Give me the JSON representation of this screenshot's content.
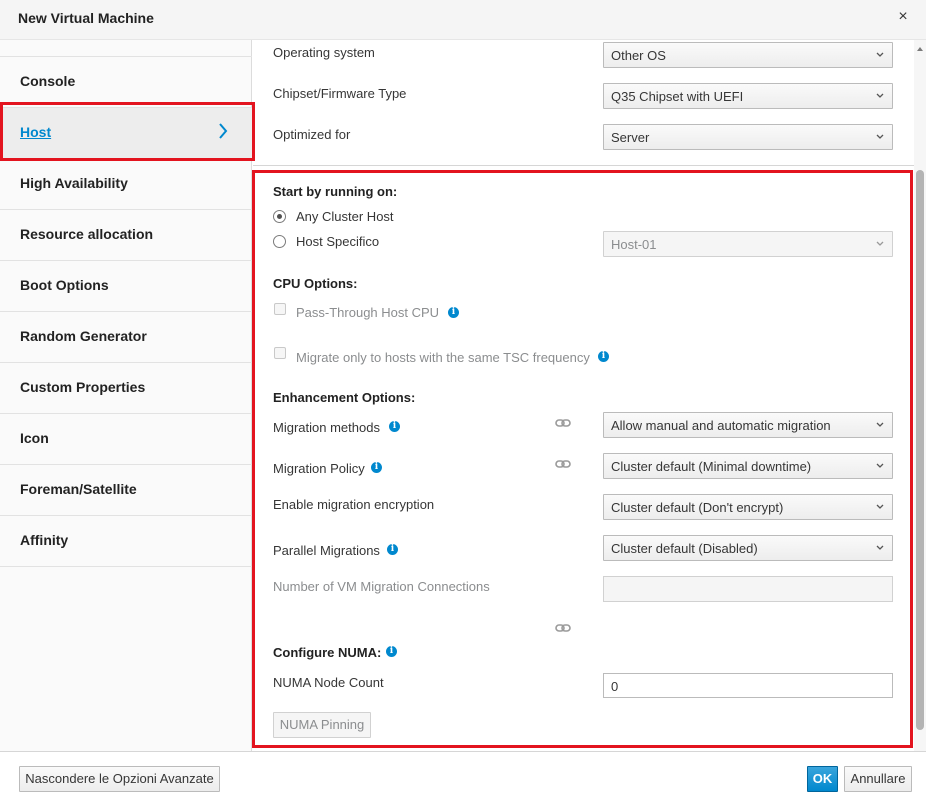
{
  "dialog": {
    "title": "New Virtual Machine",
    "close_glyph": "×"
  },
  "sidebar": {
    "items": [
      {
        "label": "Console",
        "active": false
      },
      {
        "label": "Host",
        "active": true
      },
      {
        "label": "High Availability",
        "active": false
      },
      {
        "label": "Resource allocation",
        "active": false
      },
      {
        "label": "Boot Options",
        "active": false
      },
      {
        "label": "Random Generator",
        "active": false
      },
      {
        "label": "Custom Properties",
        "active": false
      },
      {
        "label": "Icon",
        "active": false
      },
      {
        "label": "Foreman/Satellite",
        "active": false
      },
      {
        "label": "Affinity",
        "active": false
      }
    ]
  },
  "top_fields": {
    "os": {
      "label": "Operating system",
      "value": "Other OS"
    },
    "chipset": {
      "label": "Chipset/Firmware Type",
      "value": "Q35 Chipset with UEFI"
    },
    "optimized": {
      "label": "Optimized for",
      "value": "Server"
    }
  },
  "host": {
    "start_heading": "Start by running on:",
    "any_cluster_host": "Any Cluster Host",
    "host_specific": "Host Specifico",
    "host_select_value": "Host-01",
    "cpu_heading": "CPU Options:",
    "passthrough_cpu": "Pass-Through Host CPU",
    "migrate_tsc": "Migrate only to hosts with the same TSC frequency",
    "enhancement_heading": "Enhancement Options:",
    "migration_methods": {
      "label": "Migration methods",
      "value": "Allow manual and automatic migration"
    },
    "migration_policy": {
      "label": "Migration Policy",
      "value": "Cluster default (Minimal downtime)"
    },
    "migration_encryption": {
      "label": "Enable migration encryption",
      "value": "Cluster default (Don't encrypt)"
    },
    "parallel_migrations": {
      "label": "Parallel Migrations",
      "value": "Cluster default (Disabled)"
    },
    "vm_migration_connections": {
      "label": "Number of VM Migration Connections",
      "value": ""
    },
    "numa_heading": "Configure NUMA:",
    "numa_node_count": {
      "label": "NUMA Node Count",
      "value": "0"
    },
    "numa_pinning_button": "NUMA Pinning"
  },
  "footer": {
    "advanced_button": "Nascondere le Opzioni Avanzate",
    "ok_button": "OK",
    "cancel_button": "Annullare"
  },
  "colors": {
    "accent": "#0088ce",
    "highlight_border": "#e3141f",
    "primary_button": "#0088ce"
  },
  "icons": {
    "info": "info-icon",
    "link": "link-icon",
    "chevron": "chevron-right-icon",
    "close": "close-icon"
  }
}
